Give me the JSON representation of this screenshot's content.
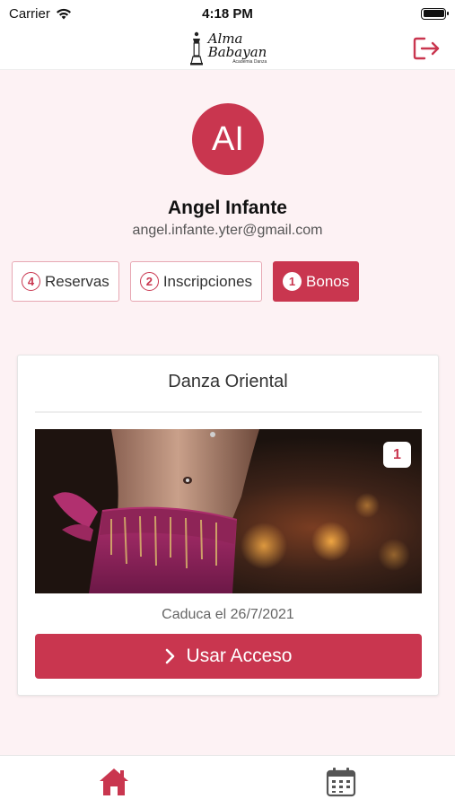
{
  "status_bar": {
    "carrier": "Carrier",
    "time": "4:18 PM",
    "wifi_icon": "wifi-icon",
    "battery_icon": "battery-icon"
  },
  "header": {
    "logo": {
      "name_line1": "Alma",
      "name_line2": "Babayan",
      "subtitle": "Academia Danza"
    },
    "logout_icon": "logout-icon"
  },
  "profile": {
    "initials": "AI",
    "name": "Angel Infante",
    "email": "angel.infante.yter@gmail.com"
  },
  "tabs": [
    {
      "count": "4",
      "label": "Reservas",
      "active": false
    },
    {
      "count": "2",
      "label": "Inscripciones",
      "active": false
    },
    {
      "count": "1",
      "label": "Bonos",
      "active": true
    }
  ],
  "card": {
    "title": "Danza Oriental",
    "image_badge": "1",
    "expiry": "Caduca el 26/7/2021",
    "button_label": "Usar Acceso",
    "button_icon": "chevron-right-icon"
  },
  "bottom_nav": {
    "home_icon": "home-icon",
    "calendar_icon": "calendar-icon"
  },
  "colors": {
    "accent": "#c9364f",
    "background": "#fdf2f4"
  }
}
